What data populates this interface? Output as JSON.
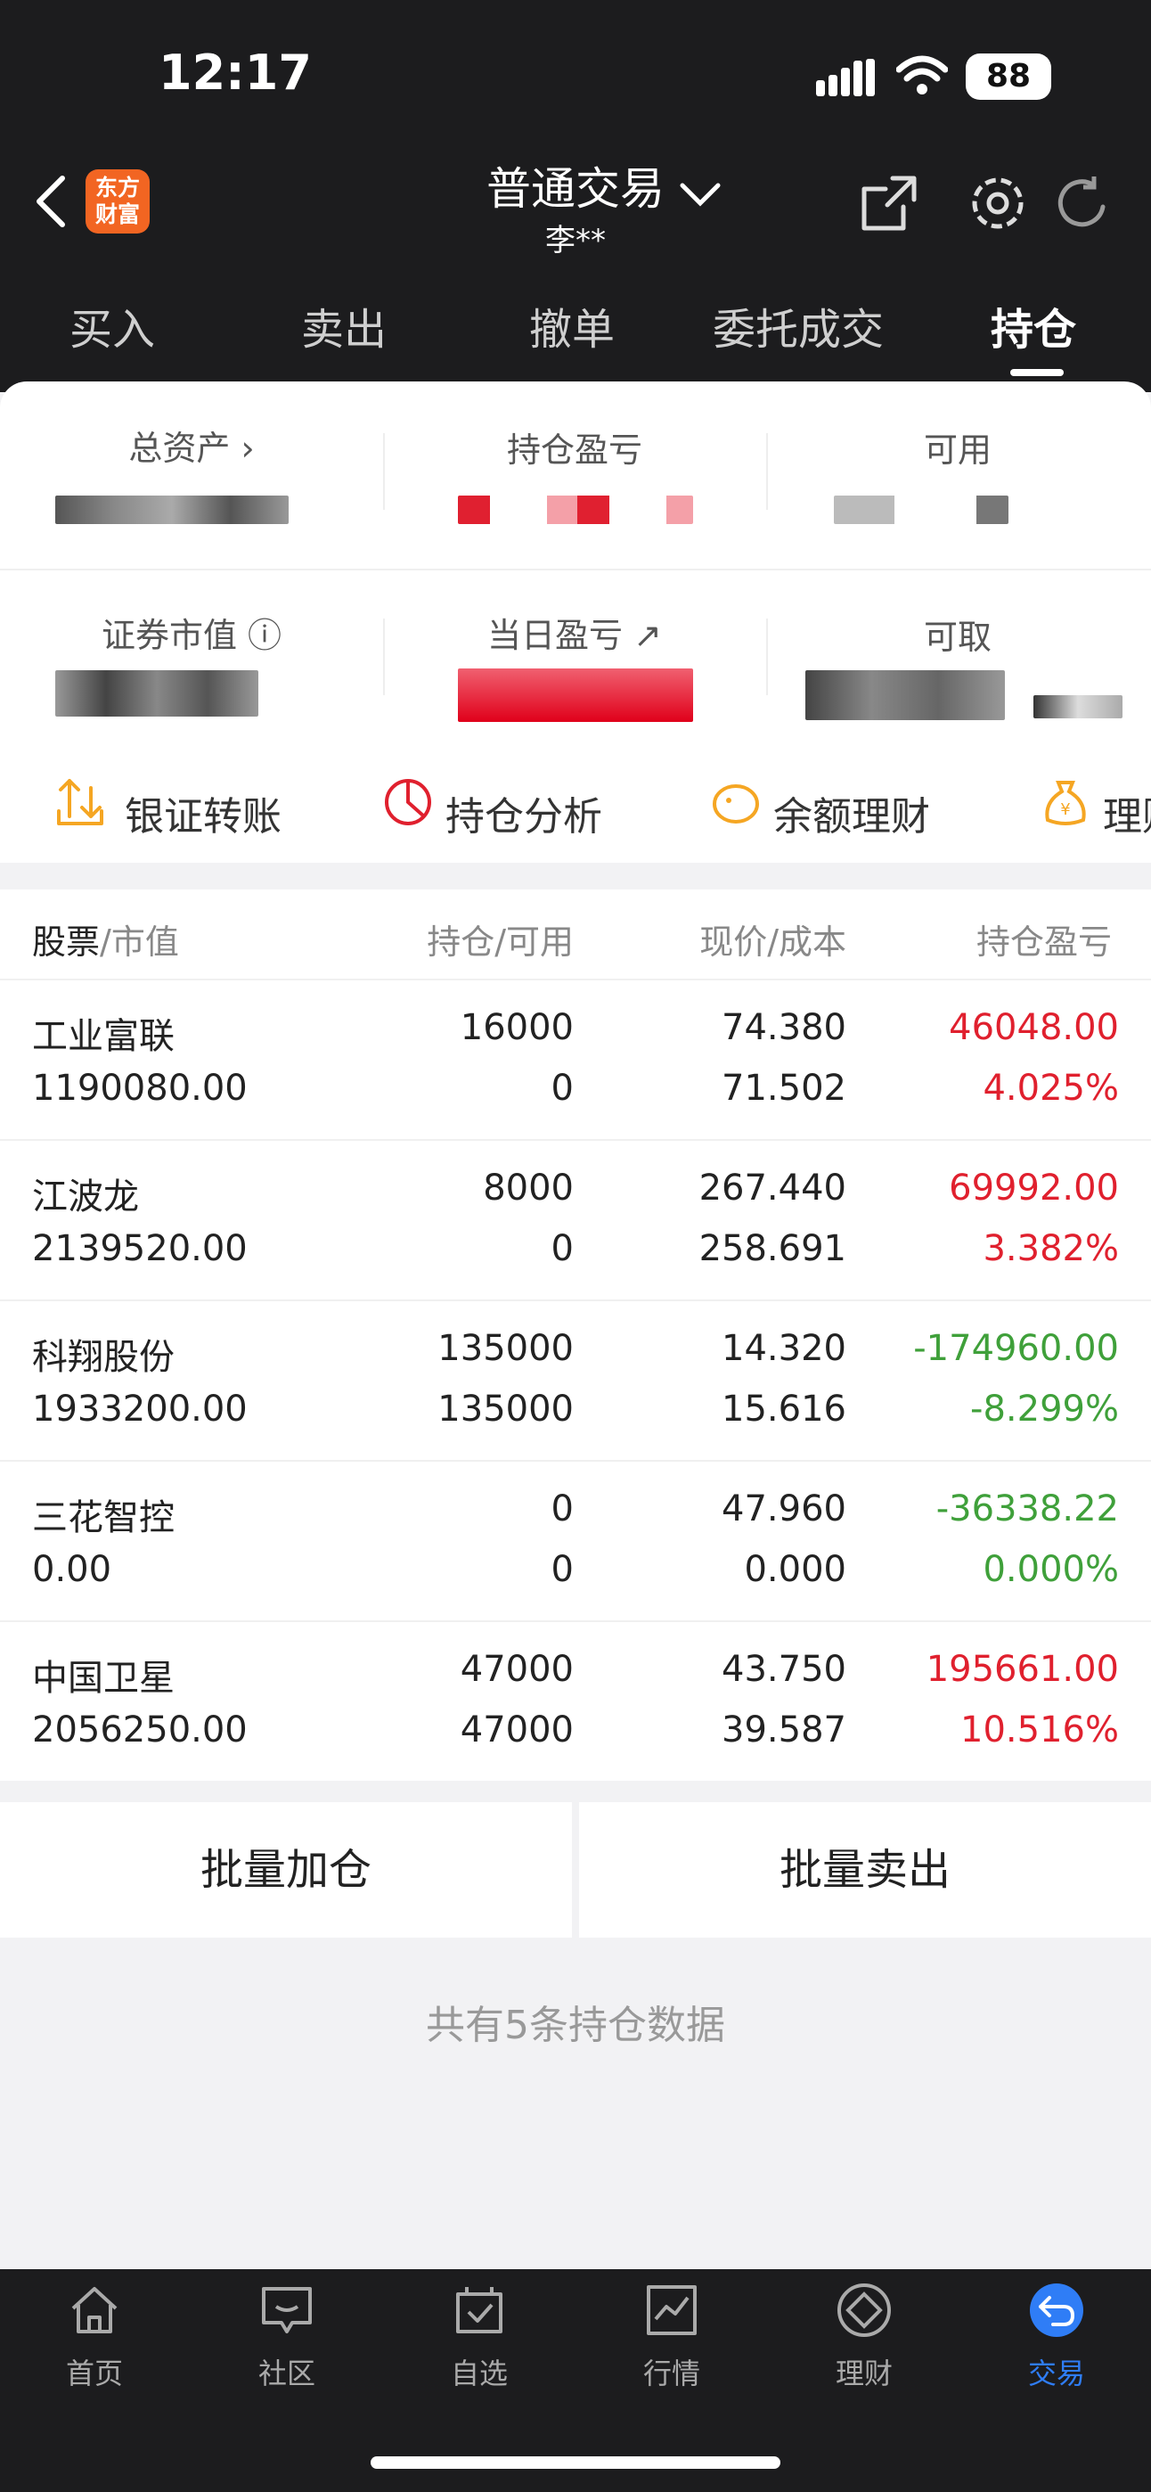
{
  "status": {
    "time": "12:17",
    "battery": "88"
  },
  "header": {
    "logo": "东方财富",
    "title": "普通交易",
    "account": "李**"
  },
  "tabs": [
    {
      "label": "买入"
    },
    {
      "label": "卖出"
    },
    {
      "label": "撤单"
    },
    {
      "label": "委托成交"
    },
    {
      "label": "持仓",
      "active": true
    }
  ],
  "summary": {
    "total_assets": "总资产",
    "position_pnl": "持仓盈亏",
    "available": "可用",
    "market_value": "证券市值",
    "daily_pnl": "当日盈亏",
    "withdrawable": "可取"
  },
  "shortcuts": [
    {
      "label": "银证转账",
      "icon": "transfer-icon"
    },
    {
      "label": "持仓分析",
      "icon": "pie-chart-icon"
    },
    {
      "label": "余额理财",
      "icon": "piggy-bank-icon"
    },
    {
      "label": "理财",
      "icon": "money-bag-icon"
    }
  ],
  "table": {
    "headers": {
      "stock": "股票",
      "market_value": "/市值",
      "position": "持仓/可用",
      "price": "现价/成本",
      "pnl": "持仓盈亏"
    },
    "rows": [
      {
        "name": "工业富联",
        "value": "1190080.00",
        "position": "16000",
        "available": "0",
        "price": "74.380",
        "cost": "71.502",
        "pnl": "46048.00",
        "pnl_pct": "4.025%",
        "trend": "up"
      },
      {
        "name": "江波龙",
        "value": "2139520.00",
        "position": "8000",
        "available": "0",
        "price": "267.440",
        "cost": "258.691",
        "pnl": "69992.00",
        "pnl_pct": "3.382%",
        "trend": "up"
      },
      {
        "name": "科翔股份",
        "value": "1933200.00",
        "position": "135000",
        "available": "135000",
        "price": "14.320",
        "cost": "15.616",
        "pnl": "-174960.00",
        "pnl_pct": "-8.299%",
        "trend": "down"
      },
      {
        "name": "三花智控",
        "value": "0.00",
        "position": "0",
        "available": "0",
        "price": "47.960",
        "cost": "0.000",
        "pnl": "-36338.22",
        "pnl_pct": "0.000%",
        "trend": "down"
      },
      {
        "name": "中国卫星",
        "value": "2056250.00",
        "position": "47000",
        "available": "47000",
        "price": "43.750",
        "cost": "39.587",
        "pnl": "195661.00",
        "pnl_pct": "10.516%",
        "trend": "up"
      }
    ]
  },
  "actions": {
    "batch_add": "批量加仓",
    "batch_sell": "批量卖出"
  },
  "footer_message": "共有5条持仓数据",
  "bottom_nav": [
    {
      "label": "首页",
      "icon": "home-icon"
    },
    {
      "label": "社区",
      "icon": "chat-icon"
    },
    {
      "label": "自选",
      "icon": "watchlist-icon"
    },
    {
      "label": "行情",
      "icon": "market-chart-icon"
    },
    {
      "label": "理财",
      "icon": "wealth-icon"
    },
    {
      "label": "交易",
      "icon": "trade-icon",
      "active": true
    }
  ],
  "colors": {
    "up": "#e0202e",
    "down": "#3fa03a",
    "accent": "#2f7df6",
    "brand": "#f26522"
  }
}
